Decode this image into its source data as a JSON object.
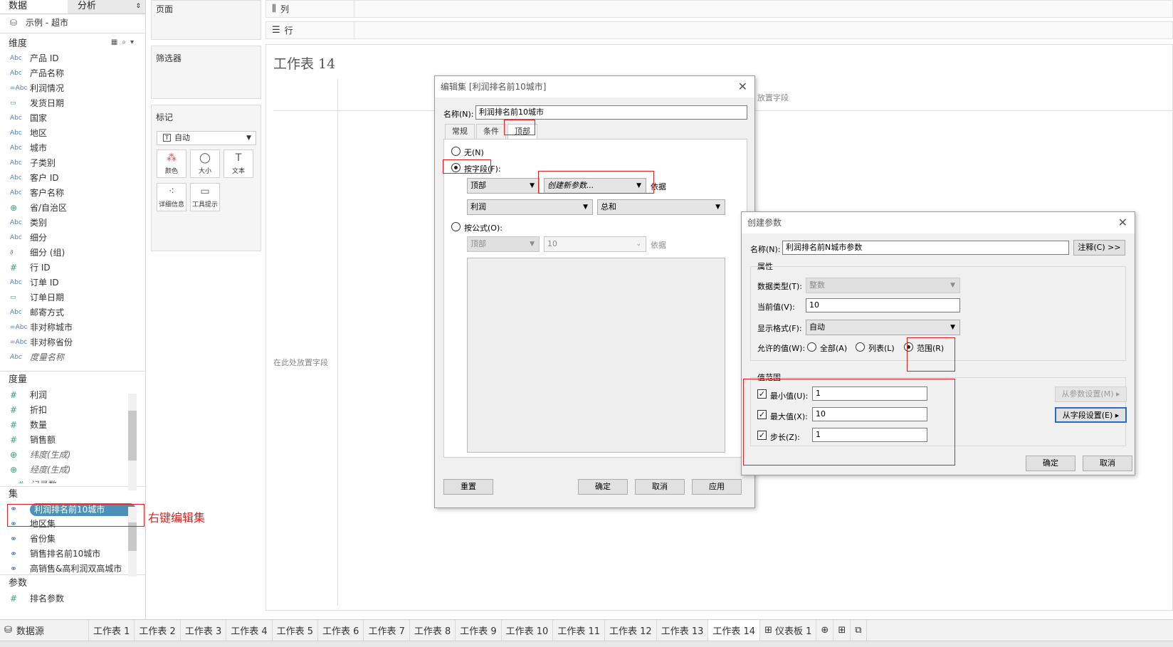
{
  "left_pane": {
    "tab_data": "数据",
    "tab_analysis": "分析",
    "datasource": "示例 - 超市",
    "dimensions_title": "维度",
    "dimensions": [
      {
        "type": "Abc",
        "name": "产品 ID"
      },
      {
        "type": "Abc",
        "name": "产品名称"
      },
      {
        "type": "=Abc",
        "name": "利润情况"
      },
      {
        "type": "date",
        "name": "发货日期"
      },
      {
        "type": "Abc",
        "name": "国家"
      },
      {
        "type": "Abc",
        "name": "地区"
      },
      {
        "type": "Abc",
        "name": "城市"
      },
      {
        "type": "Abc",
        "name": "子类别"
      },
      {
        "type": "Abc",
        "name": "客户 ID"
      },
      {
        "type": "Abc",
        "name": "客户名称"
      },
      {
        "type": "globe",
        "name": "省/自治区"
      },
      {
        "type": "Abc",
        "name": "类别"
      },
      {
        "type": "Abc",
        "name": "细分"
      },
      {
        "type": "clip",
        "name": "细分 (组)"
      },
      {
        "type": "#",
        "name": "行 ID"
      },
      {
        "type": "Abc",
        "name": "订单 ID"
      },
      {
        "type": "date",
        "name": "订单日期"
      },
      {
        "type": "Abc",
        "name": "邮寄方式"
      },
      {
        "type": "=Abc",
        "name": "非对称城市"
      },
      {
        "type": "=Abc",
        "name": "非对称省份"
      },
      {
        "type": "Abc",
        "name": "度量名称"
      }
    ],
    "measures_title": "度量",
    "measures": [
      {
        "type": "#",
        "name": "利润"
      },
      {
        "type": "#",
        "name": "折扣"
      },
      {
        "type": "#",
        "name": "数量"
      },
      {
        "type": "#",
        "name": "销售额"
      },
      {
        "type": "globe",
        "name": "纬度(生成)"
      },
      {
        "type": "globe",
        "name": "经度(生成)"
      },
      {
        "type": "=#",
        "name": "记录数"
      }
    ],
    "sets_title": "集",
    "sets": [
      "利润排名前10城市",
      "地区集",
      "省份集",
      "销售排名前10城市",
      "高销售&高利润双高城市"
    ],
    "params_title": "参数",
    "params": [
      "排名参数"
    ]
  },
  "annotation": "右键编辑集",
  "shelves": {
    "pages": "页面",
    "filters": "筛选器",
    "marks": "标记",
    "mark_type": "自动",
    "mark_buttons": [
      "颜色",
      "大小",
      "文本",
      "详细信息",
      "工具提示"
    ],
    "columns": "列",
    "rows": "行"
  },
  "sheet": {
    "title": "工作表 14",
    "drop_field": "在此处放置字段",
    "drop_field_top": "放置字段"
  },
  "edit_set_dialog": {
    "title": "编辑集 [利润排名前10城市]",
    "name_label": "名称(N):",
    "name_value": "利润排名前10城市",
    "tabs": [
      "常规",
      "条件",
      "顶部"
    ],
    "opt_none": "无(N)",
    "opt_by_field": "按字段(F):",
    "top_select": "顶部",
    "param_select": "创建新参数...",
    "by_label": "依据",
    "field_select": "利润",
    "agg_select": "总和",
    "opt_by_formula": "按公式(O):",
    "formula_top": "顶部",
    "formula_value": "10",
    "formula_by": "依据",
    "reset": "重置",
    "ok": "确定",
    "cancel": "取消",
    "apply": "应用"
  },
  "create_param_dialog": {
    "title": "创建参数",
    "name_label": "名称(N):",
    "name_value": "利润排名前N城市参数",
    "comment_btn": "注释(C) >>",
    "props_title": "属性",
    "datatype_label": "数据类型(T):",
    "datatype_value": "整数",
    "current_label": "当前值(V):",
    "current_value": "10",
    "format_label": "显示格式(F):",
    "format_value": "自动",
    "allowed_label": "允许的值(W):",
    "allowed_all": "全部(A)",
    "allowed_list": "列表(L)",
    "allowed_range": "范围(R)",
    "range_title": "值范围",
    "min_label": "最小值(U):",
    "min_value": "1",
    "max_label": "最大值(X):",
    "max_value": "10",
    "step_label": "步长(Z):",
    "step_value": "1",
    "from_param": "从参数设置(M)",
    "from_field": "从字段设置(E)",
    "ok": "确定",
    "cancel": "取消"
  },
  "bottom_tabs": {
    "datasource": "数据源",
    "sheets": [
      "工作表 1",
      "工作表 2",
      "工作表 3",
      "工作表 4",
      "工作表 5",
      "工作表 6",
      "工作表 7",
      "工作表 8",
      "工作表 9",
      "工作表 10",
      "工作表 11",
      "工作表 12",
      "工作表 13",
      "工作表 14"
    ],
    "dashboard": "仪表板 1",
    "active": "工作表 14"
  },
  "colors": {
    "accent_set": "#4a90b8",
    "red_box": "#e0201c",
    "field_type": "#4a7fb5"
  }
}
